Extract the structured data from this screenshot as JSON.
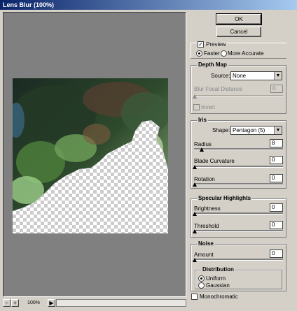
{
  "window": {
    "title": "Lens Blur (100%)"
  },
  "buttons": {
    "ok": "OK",
    "cancel": "Cancel"
  },
  "preview": {
    "label": "Preview",
    "checked": true,
    "faster": "Faster",
    "more_accurate": "More Accurate"
  },
  "depth_map": {
    "title": "Depth Map",
    "source_label": "Source:",
    "source_value": "None",
    "blur_focal_label": "Blur Focal Distance",
    "blur_focal_value": "0",
    "invert_label": "Invert"
  },
  "iris": {
    "title": "Iris",
    "shape_label": "Shape:",
    "shape_value": "Pentagon (5)",
    "radius_label": "Radius",
    "radius_value": "8",
    "blade_label": "Blade Curvature",
    "blade_value": "0",
    "rotation_label": "Rotation",
    "rotation_value": "0"
  },
  "specular": {
    "title": "Specular Highlights",
    "brightness_label": "Brightness",
    "brightness_value": "0",
    "threshold_label": "Threshold",
    "threshold_value": "0"
  },
  "noise": {
    "title": "Noise",
    "amount_label": "Amount",
    "amount_value": "0",
    "distribution_title": "Distribution",
    "uniform": "Uniform",
    "gaussian": "Gaussian",
    "monochromatic": "Monochromatic"
  },
  "statusbar": {
    "zoom_out": "−",
    "zoom_in": "+",
    "zoom": "100%",
    "arrow": "▶"
  }
}
